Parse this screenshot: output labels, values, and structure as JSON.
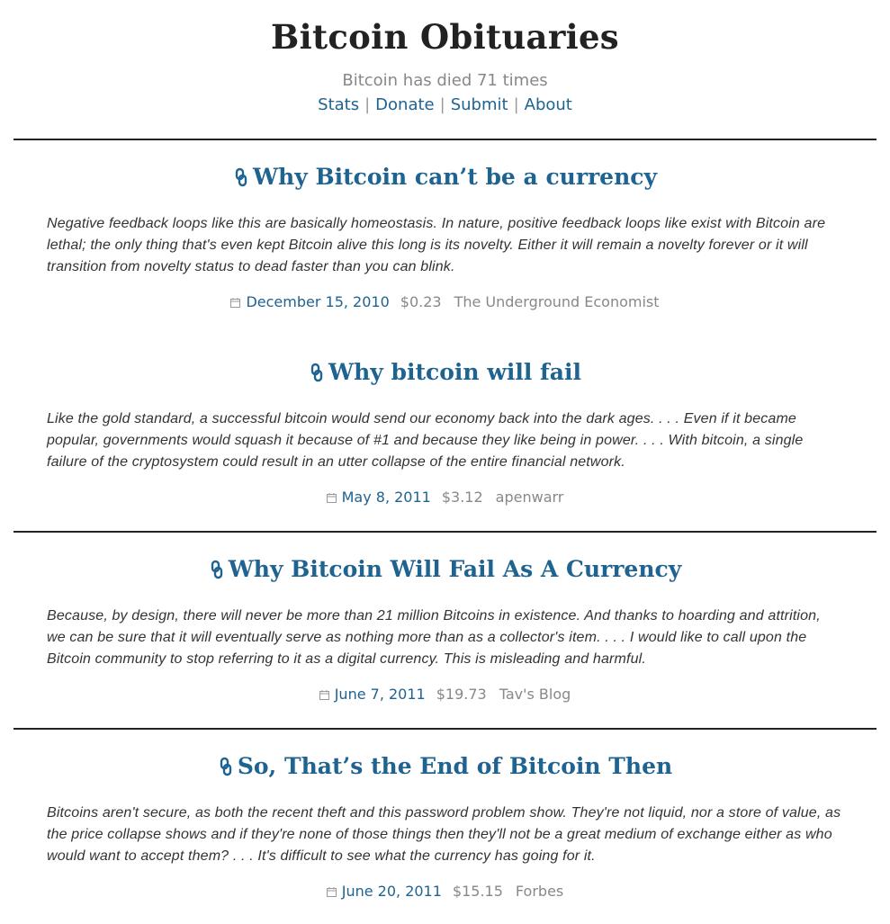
{
  "site": {
    "title": "Bitcoin Obituaries",
    "tagline": "Bitcoin has died 71 times"
  },
  "nav": {
    "stats": "Stats",
    "donate": "Donate",
    "submit": "Submit",
    "about": "About",
    "separator": "|"
  },
  "colors": {
    "link": "#1f6391",
    "muted": "#888888",
    "rule": "#222222"
  },
  "icons": {
    "title_link": "link-chain-icon",
    "date": "calendar-icon"
  },
  "entries": [
    {
      "title": "Why Bitcoin can’t be a currency",
      "quote": "Negative feedback loops like this are basically homeostasis. In nature, positive feedback loops like exist with Bitcoin are lethal; the only thing that's even kept Bitcoin alive this long is its novelty. Either it will remain a novelty forever or it will transition from novelty status to dead faster than you can blink.",
      "date": "December 15, 2010",
      "price": "$0.23",
      "source": "The Underground Economist"
    },
    {
      "title": "Why bitcoin will fail",
      "quote": "Like the gold standard, a successful bitcoin would send our economy back into the dark ages. . . . Even if it became popular, governments would squash it because of #1 and because they like being in power. . . . With bitcoin, a single failure of the cryptosystem could result in an utter collapse of the entire financial network.",
      "date": "May 8, 2011",
      "price": "$3.12",
      "source": "apenwarr"
    },
    {
      "title": "Why Bitcoin Will Fail As A Currency",
      "quote": "Because, by design, there will never be more than 21 million Bitcoins in existence. And thanks to hoarding and attrition, we can be sure that it will eventually serve as nothing more than as a collector's item. . . . I would like to call upon the Bitcoin community to stop referring to it as a digital currency. This is misleading and harmful.",
      "date": "June 7, 2011",
      "price": "$19.73",
      "source": "Tav's Blog"
    },
    {
      "title": "So, That’s the End of Bitcoin Then",
      "quote": "Bitcoins aren't secure, as both the recent theft and this password problem show. They're not liquid, nor a store of value, as the price collapse shows and if they're none of those things then they'll not be a great medium of exchange either as who would want to accept them? . . . It's difficult to see what the currency has going for it.",
      "date": "June 20, 2011",
      "price": "$15.15",
      "source": "Forbes"
    }
  ]
}
